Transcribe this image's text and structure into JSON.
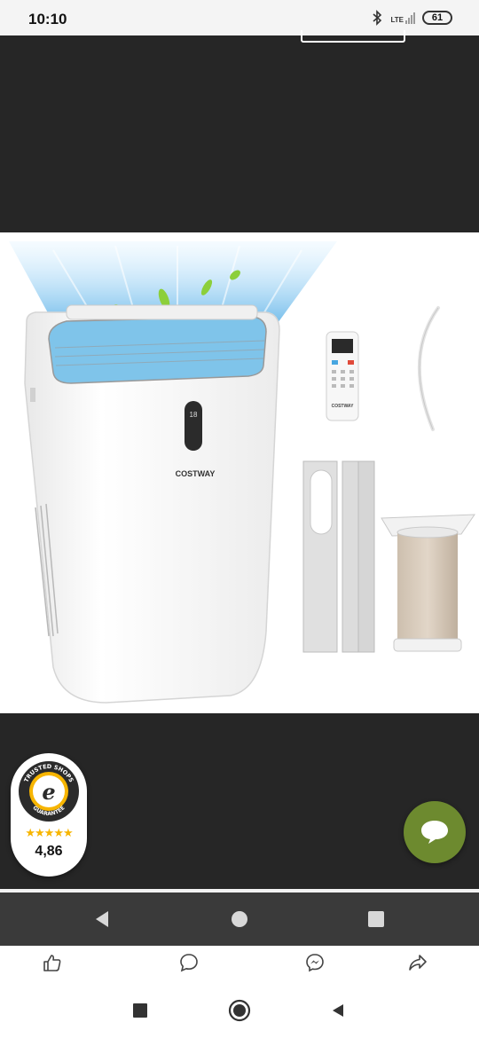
{
  "status_bar": {
    "time": "10:10",
    "network": "LTE",
    "battery": "61",
    "icons": [
      "bluetooth-icon",
      "signal-icon",
      "battery-icon"
    ]
  },
  "product_image": {
    "brand_text": "COSTWAY",
    "display_text": "18",
    "remote_brand": "COSTWAY"
  },
  "trust_badge": {
    "seal_top_text": "TRUSTED SHOPS",
    "seal_bottom_text": "GUARANTEE",
    "stars": "★★★★★",
    "rating": "4,86"
  },
  "chat": {
    "icon": "chat-bubble-icon",
    "color": "#6d8a2f"
  },
  "inner_nav": {
    "icons": [
      "back-triangle-icon",
      "home-circle-icon",
      "recents-square-icon"
    ]
  },
  "action_bar": {
    "items": [
      {
        "icon": "thumbs-up-icon"
      },
      {
        "icon": "comment-icon"
      },
      {
        "icon": "messenger-icon"
      },
      {
        "icon": "share-icon"
      }
    ]
  },
  "system_nav": {
    "icons": [
      "recents-square-icon",
      "home-circle-icon",
      "back-triangle-icon"
    ]
  }
}
